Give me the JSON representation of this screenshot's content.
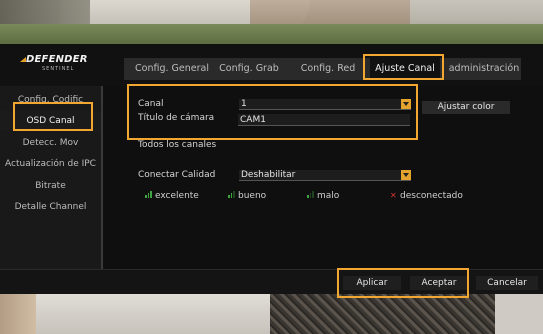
{
  "header": {
    "brand": "DEFENDER",
    "brand_sub": "SENTINEL",
    "tabs": [
      "Config. General",
      "Config. Grab",
      "Config. Red",
      "Ajuste Canal",
      "administración"
    ],
    "active_tab": "Ajuste Canal"
  },
  "sidebar": {
    "items": [
      "Config. Codific",
      "OSD Canal",
      "Detecc. Mov",
      "Actualización de IPC",
      "Bitrate",
      "Detalle Channel"
    ],
    "active_item": "OSD Canal"
  },
  "form": {
    "canal_label": "Canal",
    "canal_value": "1",
    "titulo_label": "Título de cámara",
    "titulo_value": "CAM1",
    "ajustar_color": "Ajustar color",
    "todos_canales": "Todos los canales",
    "calidad_label": "Conectar Calidad",
    "calidad_value": "Deshabilitar"
  },
  "legend": {
    "excelente": "excelente",
    "bueno": "bueno",
    "malo": "malo",
    "desconectado": "desconectado"
  },
  "footer": {
    "aplicar": "Aplicar",
    "aceptar": "Aceptar",
    "cancelar": "Cancelar"
  },
  "colors": {
    "highlight": "#f3a733",
    "signal_good": "#3fa33f",
    "signal_disconnected": "#d33333",
    "dropdown_caret": "#e3a32d"
  },
  "icons": {
    "signal": "signal-bars-icon",
    "disconnected": "disconnected-x-icon",
    "dropdown": "chevron-down-icon"
  }
}
